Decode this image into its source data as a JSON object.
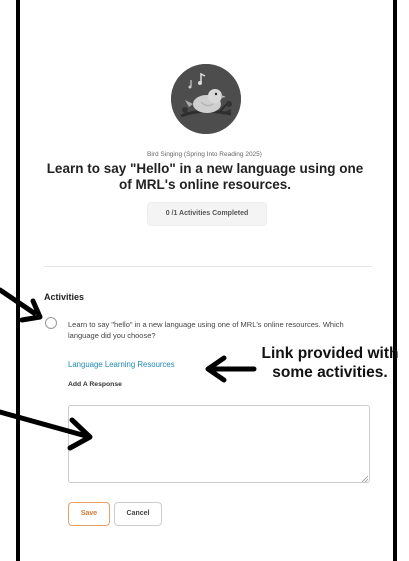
{
  "header": {
    "subtitle": "Bird Singing (Spring Into Reading 2025)",
    "title": "Learn to say \"Hello\" in a new language using one of MRL's online resources.",
    "progress": "0 /1 Activities Completed"
  },
  "activities": {
    "heading": "Activities",
    "item": {
      "text": "Learn to say \"hello\" in a new language using one of MRL's online resources. Which language did you choose?",
      "link": "Language Learning Resources",
      "response_label": "Add A Response",
      "response_value": ""
    }
  },
  "buttons": {
    "save": "Save",
    "cancel": "Cancel"
  },
  "annotation": {
    "callout": "Link provided with some activities."
  },
  "icons": {
    "avatar": "bird-icon",
    "radio": "radio-unchecked-icon"
  },
  "colors": {
    "link": "#1f8ab8",
    "save_accent": "#d97a35",
    "avatar_bg": "#555555"
  }
}
